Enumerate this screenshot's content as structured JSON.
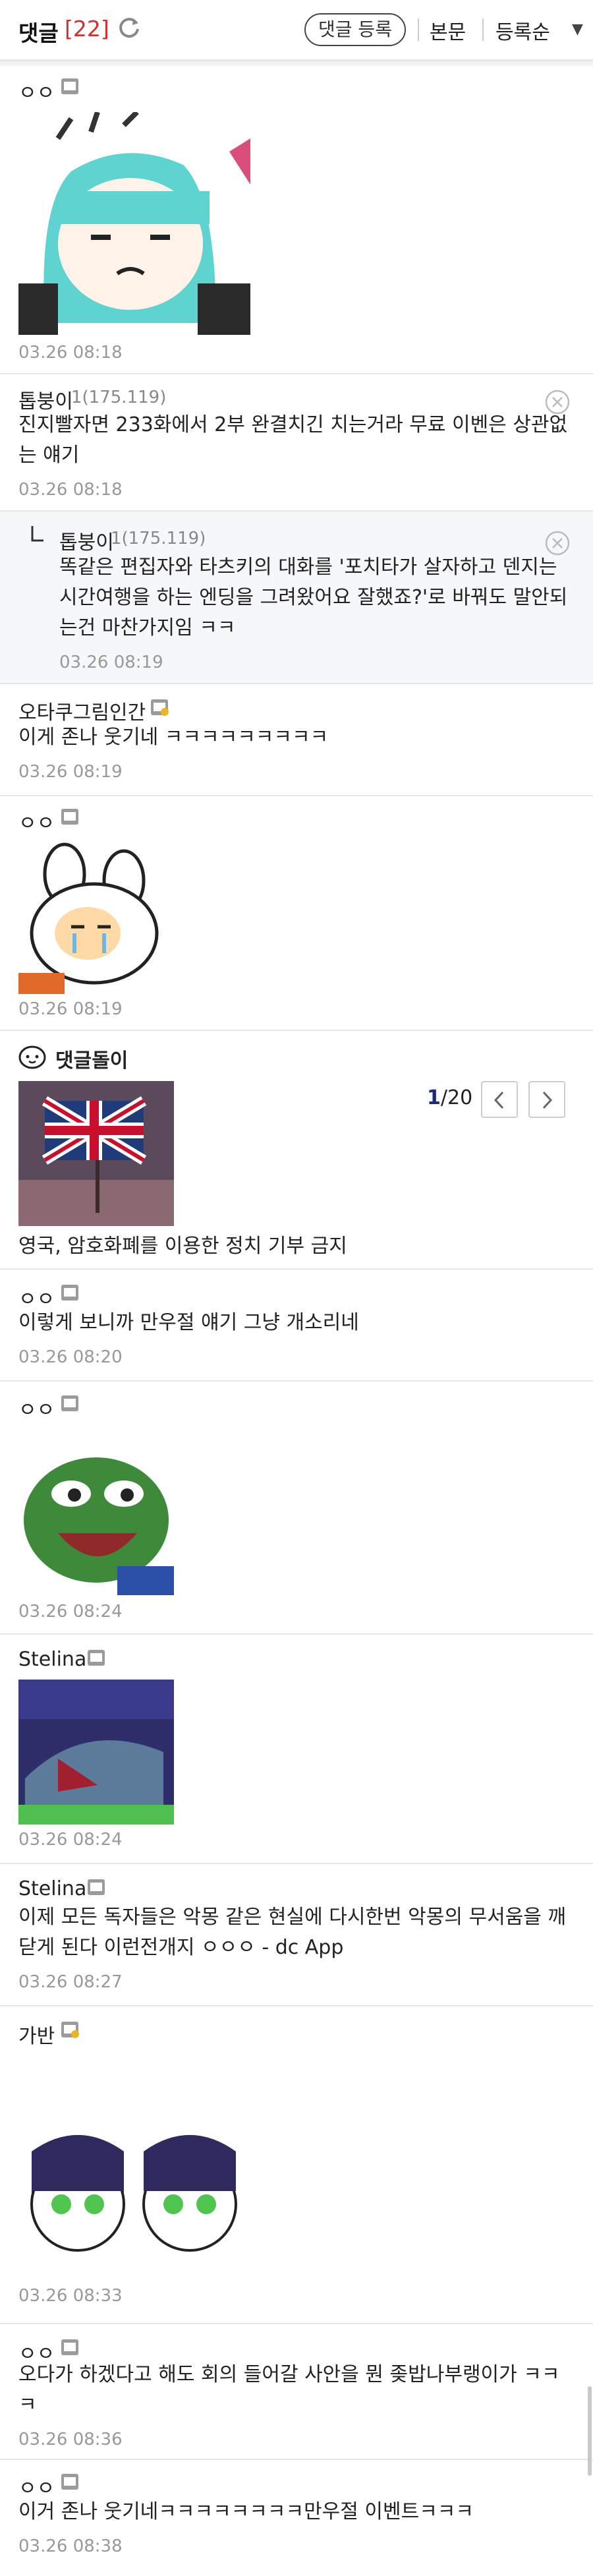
{
  "header": {
    "title": "댓글",
    "count": "[22]",
    "register_button": "댓글 등록",
    "body_link": "본문",
    "sort_label": "등록순"
  },
  "comments": [
    {
      "nick": "ㅇㅇ",
      "time": "03.26 08:18"
    },
    {
      "nick": "톱붕이",
      "ip": "1(175.119)",
      "text1": "진지빨자면 233화에서 2부 완결치긴 치는거라 무료 이벤은 상관없",
      "text2": "는 얘기",
      "time": "03.26 08:18"
    },
    {
      "nick": "톱붕이",
      "ip": "1(175.119)",
      "text1": "똑같은 편집자와 타츠키의 대화를 '포치타가 살자하고 덴지는",
      "text2": "시간여행을 하는 엔딩을 그려왔어요 잘했죠?'로 바꿔도 말안되",
      "text3": "는건 마찬가지임 ㅋㅋ",
      "time": "03.26 08:19"
    },
    {
      "nick": "오타쿠그림인간",
      "text1": "이게 존나 웃기네 ㅋㅋㅋㅋㅋㅋㅋㅋㅋ",
      "time": "03.26 08:19"
    },
    {
      "nick": "ㅇㅇ",
      "time": "03.26 08:19"
    },
    {
      "nick": "ㅇㅇ",
      "text1": "이렇게 보니까 만우절 얘기 그냥 개소리네",
      "time": "03.26 08:20"
    },
    {
      "nick": "ㅇㅇ",
      "time": "03.26 08:24"
    },
    {
      "nick": "Stelina",
      "time": "03.26 08:24"
    },
    {
      "nick": "Stelina",
      "text1": "이제 모든 독자들은 악몽 같은 현실에 다시한번 악몽의 무서움을 깨",
      "text2": "닫게 된다 이런전개지 ㅇㅇㅇ - dc App",
      "time": "03.26 08:27"
    },
    {
      "nick": "가반",
      "time": "03.26 08:33"
    },
    {
      "nick": "ㅇㅇ",
      "text1": "오다가 하겠다고 해도 회의 들어갈 사안을 뭔 좆밥나부랭이가 ㅋㅋ",
      "text2": "ㅋ",
      "time": "03.26 08:36"
    },
    {
      "nick": "ㅇㅇ",
      "text1": "이거 존나 웃기네ㅋㅋㅋㅋㅋㅋㅋㅋ만우절 이벤트ㅋㅋㅋ",
      "time": "03.26 08:38"
    }
  ],
  "ad": {
    "label": "댓글돌이",
    "title": "영국, 암호화폐를 이용한 정치 기부 금지",
    "page_current": "1",
    "page_total": "/20"
  },
  "colors": {
    "accent": "#1d2a7c",
    "count_red": "#d12f2f",
    "reply_bg": "#f6f7f9"
  }
}
